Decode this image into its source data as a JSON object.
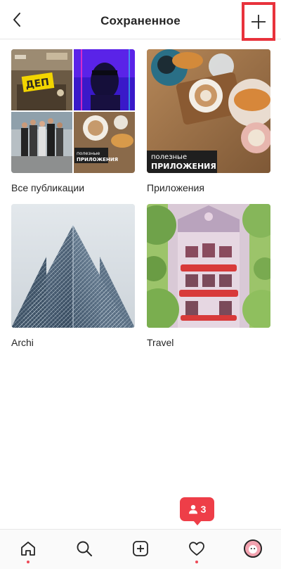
{
  "header": {
    "title": "Сохраненное"
  },
  "collections": [
    {
      "label": "Все публикации",
      "overlay_small": "полезные",
      "overlay_big": "ПРИЛОЖЕНИЯ",
      "sign_text": "ДЕП"
    },
    {
      "label": "Приложения",
      "overlay_small": "полезные",
      "overlay_big": "ПРИЛОЖЕНИЯ"
    },
    {
      "label": "Archi"
    },
    {
      "label": "Travel"
    }
  ],
  "notification": {
    "count": "3",
    "icon": "person-icon",
    "color": "#ee3e48"
  },
  "bottom_nav": {
    "items": [
      "home-icon",
      "search-icon",
      "add-post-icon",
      "heart-icon",
      "profile-avatar"
    ],
    "accent": "#ed4956"
  },
  "colors": {
    "highlight_frame": "#e8323c"
  }
}
